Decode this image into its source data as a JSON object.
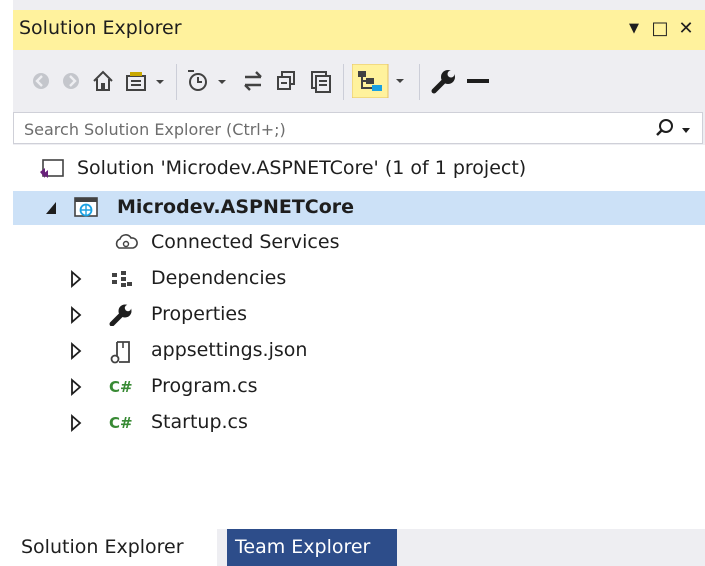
{
  "panel": {
    "title": "Solution Explorer",
    "controls": {
      "dropdown": "▼",
      "maximize": "□",
      "close": "✕"
    }
  },
  "toolbar": {
    "buttons": [
      {
        "name": "back-icon",
        "enabled": false
      },
      {
        "name": "forward-icon",
        "enabled": false
      },
      {
        "name": "home-icon",
        "enabled": true
      },
      {
        "name": "switch-views-icon",
        "enabled": true,
        "dropdown": true
      },
      {
        "name": "pending-changes-filter-icon",
        "enabled": true,
        "dropdown": true
      },
      {
        "name": "sync-with-active-document-icon",
        "enabled": true
      },
      {
        "name": "collapse-all-icon",
        "enabled": true
      },
      {
        "name": "show-all-files-icon",
        "enabled": true
      },
      {
        "name": "preview-selected-items-icon",
        "enabled": true,
        "active": true,
        "dropdown": true
      },
      {
        "name": "properties-wrench-icon",
        "enabled": true
      },
      {
        "name": "minus-icon",
        "enabled": true
      }
    ]
  },
  "search": {
    "placeholder": "Search Solution Explorer (Ctrl+;)",
    "icon": "search-icon"
  },
  "tree": {
    "solution": {
      "label": "Solution 'Microdev.ASPNETCore' (1 of 1 project)",
      "icon": "solution-icon"
    },
    "project": {
      "label": "Microdev.ASPNETCore",
      "icon": "web-project-icon",
      "expanded": true,
      "selected": true
    },
    "items": [
      {
        "label": "Connected Services",
        "icon": "connected-services-icon",
        "expandable": false
      },
      {
        "label": "Dependencies",
        "icon": "dependencies-icon",
        "expandable": true
      },
      {
        "label": "Properties",
        "icon": "wrench-icon",
        "expandable": true
      },
      {
        "label": "appsettings.json",
        "icon": "json-file-icon",
        "expandable": true
      },
      {
        "label": "Program.cs",
        "icon": "csharp-file-icon",
        "expandable": true,
        "badge": "C#"
      },
      {
        "label": "Startup.cs",
        "icon": "csharp-file-icon",
        "expandable": true,
        "badge": "C#"
      }
    ]
  },
  "tabs": [
    {
      "label": "Solution Explorer",
      "active": true
    },
    {
      "label": "Team Explorer",
      "active": false
    }
  ],
  "colors": {
    "titlebar": "#fff29d",
    "selection": "#cce1f7",
    "inactive_tab": "#2d4d8a",
    "csharp_green": "#388a34"
  }
}
